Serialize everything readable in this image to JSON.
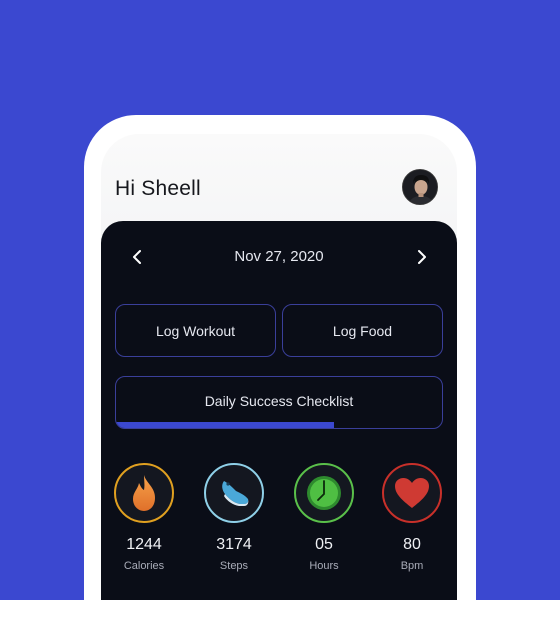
{
  "header": {
    "greeting": "Hi Sheell"
  },
  "date_nav": {
    "date": "Nov 27, 2020",
    "prev_icon": "chevron-left-icon",
    "next_icon": "chevron-right-icon"
  },
  "actions": {
    "log_workout": "Log Workout",
    "log_food": "Log Food"
  },
  "checklist": {
    "label": "Daily Success Checklist",
    "progress": 0.67
  },
  "stats": [
    {
      "value": "1244",
      "label": "Calories",
      "icon": "flame-icon",
      "ring_color": "#e0a020"
    },
    {
      "value": "3174",
      "label": "Steps",
      "icon": "shoe-icon",
      "ring_color": "#8fd0e8"
    },
    {
      "value": "05",
      "label": "Hours",
      "icon": "clock-icon",
      "ring_color": "#5ac04a"
    },
    {
      "value": "80",
      "label": "Bpm",
      "icon": "heart-icon",
      "ring_color": "#c8302a"
    }
  ],
  "colors": {
    "background": "#3b48d0",
    "panel": "#0a0d17",
    "accent": "#3b48d0"
  }
}
